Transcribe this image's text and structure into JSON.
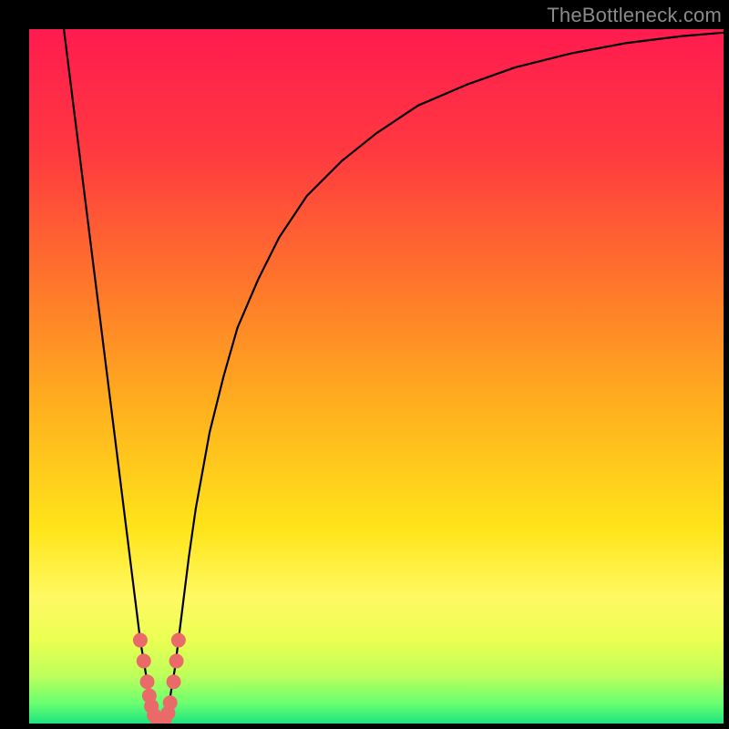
{
  "watermark": "TheBottleneck.com",
  "colors": {
    "frame": "#000000",
    "gradient_stops": [
      {
        "offset": 0.0,
        "color": "#ff1b4f"
      },
      {
        "offset": 0.18,
        "color": "#ff3a3f"
      },
      {
        "offset": 0.38,
        "color": "#ff7a2a"
      },
      {
        "offset": 0.55,
        "color": "#ffb21e"
      },
      {
        "offset": 0.72,
        "color": "#ffe41a"
      },
      {
        "offset": 0.82,
        "color": "#fff963"
      },
      {
        "offset": 0.88,
        "color": "#eaff52"
      },
      {
        "offset": 0.93,
        "color": "#bfff5a"
      },
      {
        "offset": 0.97,
        "color": "#6bff70"
      },
      {
        "offset": 1.0,
        "color": "#20e47e"
      }
    ],
    "curve": "#000000",
    "marker": "#ea6a6a"
  },
  "chart_data": {
    "type": "line",
    "title": "",
    "xlabel": "",
    "ylabel": "",
    "xlim": [
      0,
      100
    ],
    "ylim": [
      0,
      100
    ],
    "series": [
      {
        "name": "bottleneck-percentage-curve",
        "x": [
          5,
          6,
          7,
          8,
          9,
          10,
          11,
          12,
          13,
          14,
          15,
          16,
          17,
          18,
          19,
          20,
          21,
          22,
          23,
          24,
          26,
          28,
          30,
          33,
          36,
          40,
          45,
          50,
          56,
          63,
          70,
          78,
          86,
          94,
          100
        ],
        "y": [
          100,
          92,
          84,
          76,
          68,
          60,
          52,
          44,
          36,
          28,
          20,
          12,
          6,
          1,
          0,
          2,
          8,
          16,
          24,
          31,
          42,
          50,
          57,
          64,
          70,
          76,
          81,
          85,
          89,
          92,
          94.5,
          96.5,
          98,
          99,
          99.5
        ]
      }
    ],
    "markers": {
      "name": "highlighted-points",
      "points": [
        {
          "x": 16,
          "y": 12
        },
        {
          "x": 16.5,
          "y": 9
        },
        {
          "x": 17,
          "y": 6
        },
        {
          "x": 17.3,
          "y": 4
        },
        {
          "x": 17.6,
          "y": 2.5
        },
        {
          "x": 18,
          "y": 1.2
        },
        {
          "x": 18.5,
          "y": 0.5
        },
        {
          "x": 19,
          "y": 0
        },
        {
          "x": 19.5,
          "y": 0.5
        },
        {
          "x": 20,
          "y": 1.5
        },
        {
          "x": 20.3,
          "y": 3
        },
        {
          "x": 20.8,
          "y": 6
        },
        {
          "x": 21.2,
          "y": 9
        },
        {
          "x": 21.5,
          "y": 12
        }
      ]
    }
  }
}
